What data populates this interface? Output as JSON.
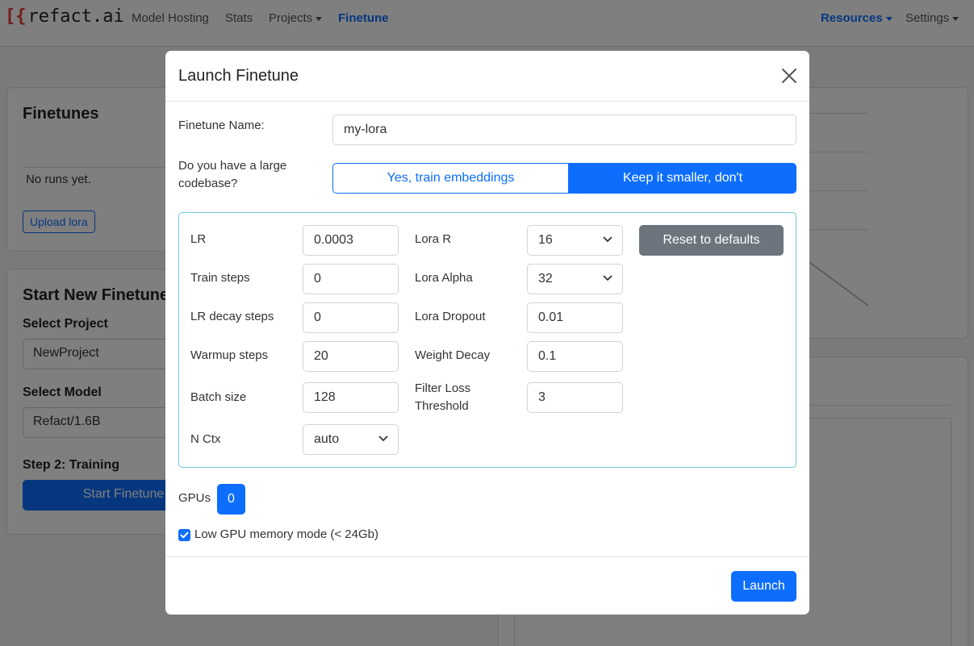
{
  "navbar": {
    "brand": "refact.ai",
    "links": [
      "Model Hosting",
      "Stats",
      "Projects",
      "Finetune"
    ],
    "right_links": [
      "Resources",
      "Settings"
    ]
  },
  "background": {
    "finetunes_title": "Finetunes",
    "no_runs": "No runs yet.",
    "upload_lora": "Upload lora",
    "start_title": "Start New Finetune",
    "select_project_label": "Select Project",
    "project_value": "NewProject",
    "select_model_label": "Select Model",
    "model_value": "Refact/1.6B",
    "step2_label": "Step 2: Training",
    "start_button": "Start Finetune"
  },
  "modal": {
    "title": "Launch Finetune",
    "finetune_name_label": "Finetune Name:",
    "finetune_name_value": "my-lora",
    "codebase_question": "Do you have a large codebase?",
    "embeddings_yes": "Yes, train embeddings",
    "embeddings_no": "Keep it smaller, don't",
    "params_left": [
      {
        "label": "LR",
        "value": "0.0003"
      },
      {
        "label": "Train steps",
        "value": "0"
      },
      {
        "label": "LR decay steps",
        "value": "0"
      },
      {
        "label": "Warmup steps",
        "value": "20"
      },
      {
        "label": "Batch size",
        "value": "128"
      },
      {
        "label": "N Ctx",
        "value": "auto"
      }
    ],
    "params_right": [
      {
        "label": "Lora R",
        "value": "16"
      },
      {
        "label": "Lora Alpha",
        "value": "32"
      },
      {
        "label": "Lora Dropout",
        "value": "0.01"
      },
      {
        "label": "Weight Decay",
        "value": "0.1"
      },
      {
        "label": "Filter Loss Threshold",
        "value": "3"
      }
    ],
    "reset_button": "Reset to defaults",
    "gpus_label": "GPUs",
    "gpu_value": "0",
    "low_mem_label": "Low GPU memory mode (< 24Gb)",
    "low_mem_checked": true,
    "launch_button": "Launch"
  },
  "colors": {
    "primary": "#0d6efd",
    "secondary": "#6c757d",
    "params_border": "#6ec9d6",
    "brand_bracket": "#e53935"
  }
}
